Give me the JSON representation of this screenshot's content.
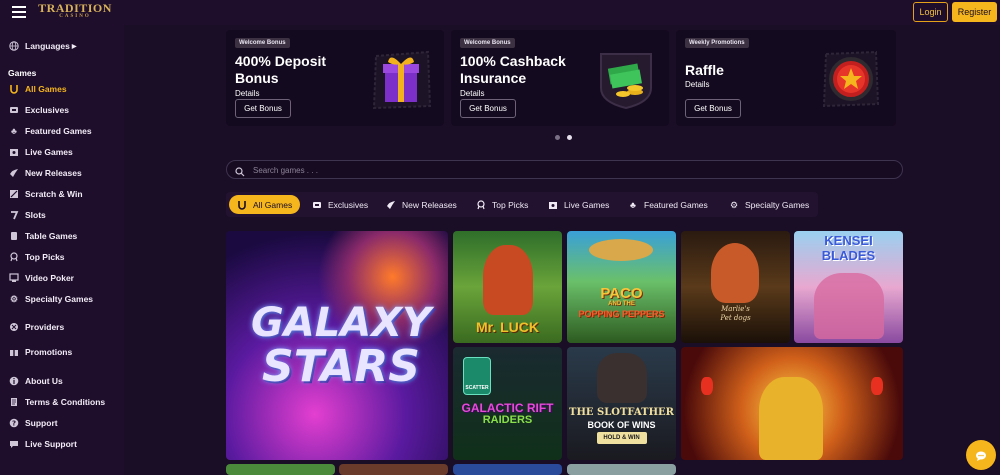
{
  "header": {
    "logo_text": "TRADITION",
    "logo_sub": "CASINO",
    "login_label": "Login",
    "register_label": "Register"
  },
  "sidebar": {
    "languages": "Languages",
    "games_heading": "Games",
    "items": [
      {
        "label": "All Games",
        "icon": "horseshoe-icon"
      },
      {
        "label": "Exclusives",
        "icon": "exclusive-icon"
      },
      {
        "label": "Featured Games",
        "icon": "clover-icon"
      },
      {
        "label": "Live Games",
        "icon": "live-icon"
      },
      {
        "label": "New Releases",
        "icon": "new-icon"
      },
      {
        "label": "Scratch & Win",
        "icon": "scratch-icon"
      },
      {
        "label": "Slots",
        "icon": "slot-icon"
      },
      {
        "label": "Table Games",
        "icon": "cards-icon"
      },
      {
        "label": "Top Picks",
        "icon": "medal-icon"
      },
      {
        "label": "Video Poker",
        "icon": "video-poker-icon"
      },
      {
        "label": "Specialty Games",
        "icon": "gear-icon"
      }
    ],
    "providers": "Providers",
    "promotions": "Promotions",
    "footer_items": [
      {
        "label": "About Us",
        "icon": "info-icon"
      },
      {
        "label": "Terms & Conditions",
        "icon": "document-icon"
      },
      {
        "label": "Support",
        "icon": "help-icon"
      },
      {
        "label": "Live Support",
        "icon": "chat-icon"
      }
    ]
  },
  "promos": [
    {
      "tag": "Welcome Bonus",
      "title": "400% Deposit Bonus",
      "details": "Details",
      "button": "Get Bonus",
      "icon": "gift-box-icon"
    },
    {
      "tag": "Welcome Bonus",
      "title": "100% Cashback Insurance",
      "details": "Details",
      "button": "Get Bonus",
      "icon": "cash-stack-icon"
    },
    {
      "tag": "Weekly Promotions",
      "title": "Raffle",
      "details": "Details",
      "button": "Get Bonus",
      "icon": "raffle-star-icon"
    }
  ],
  "search": {
    "placeholder": "Search games . . ."
  },
  "categories": [
    {
      "label": "All Games",
      "icon": "horseshoe-icon"
    },
    {
      "label": "Exclusives",
      "icon": "exclusive-icon"
    },
    {
      "label": "New Releases",
      "icon": "new-icon"
    },
    {
      "label": "Top Picks",
      "icon": "medal-icon"
    },
    {
      "label": "Live Games",
      "icon": "live-icon"
    },
    {
      "label": "Featured Games",
      "icon": "clover-icon"
    },
    {
      "label": "Specialty Games",
      "icon": "gear-icon"
    }
  ],
  "games": [
    {
      "title_line1": "GALAXY",
      "title_line2": "STARS"
    },
    {
      "title_line1": "Mr. LUCK"
    },
    {
      "title_line1": "PACO",
      "title_line2": "AND THE",
      "title_line3": "POPPING PEPPERS"
    },
    {
      "title_line1": "Marlie's",
      "title_line2": "Pet dogs"
    },
    {
      "title_line1": "KENSEI",
      "title_line2": "BLADES"
    },
    {
      "title_line1": "SCATTER",
      "title_line2": "GALACTIC RIFT",
      "title_line3": "RAIDERS"
    },
    {
      "title_line1": "THE SLOTFATHER",
      "title_line2": "BOOK OF WINS",
      "title_line3": "HOLD & WIN"
    },
    {
      "title_line1": ""
    }
  ],
  "colors": {
    "accent": "#f5b51c",
    "bg": "#1a0d26",
    "panel": "#1e0e2c"
  }
}
